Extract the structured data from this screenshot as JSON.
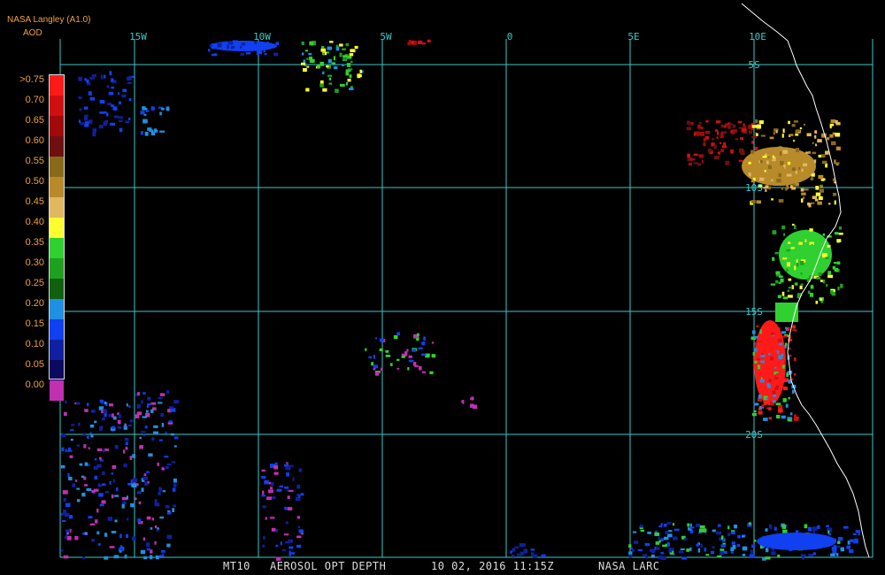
{
  "source_label": "NASA Langley (A1.0)",
  "product_label": "AOD",
  "colors": {
    "grid": "#3cc8c8",
    "coast": "#ffffff",
    "label_text": "#f0a040"
  },
  "longitude_labels": [
    "15W",
    "10W",
    "5W",
    "0",
    "5E",
    "10E"
  ],
  "latitude_labels": [
    "5S",
    "10S",
    "15S",
    "20S"
  ],
  "legend": {
    "levels": [
      ">0.75",
      "0.70",
      "0.65",
      "0.60",
      "0.55",
      "0.50",
      "0.45",
      "0.40",
      "0.35",
      "0.30",
      "0.25",
      "0.20",
      "0.15",
      "0.10",
      "0.05",
      "0.00"
    ],
    "colors": [
      "#ff1a1a",
      "#d01010",
      "#a00a0a",
      "#6e1010",
      "#8a6a1a",
      "#b88a2a",
      "#e0b860",
      "#ffff30",
      "#30d030",
      "#20a020",
      "#106010",
      "#2090e0",
      "#1040f0",
      "#1020a0",
      "#0a0a60",
      "#c030b0"
    ]
  },
  "footer": {
    "sensor": "MT10",
    "parameter": "AEROSOL OPT DEPTH",
    "datetime": "10 02, 2016 11:15Z",
    "producer": "NASA LARC"
  }
}
